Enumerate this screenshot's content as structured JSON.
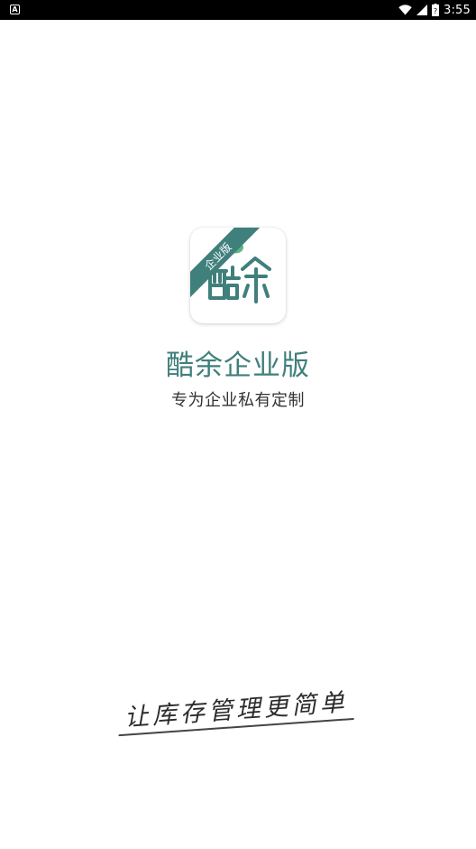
{
  "status_bar": {
    "left_icon_label": "A",
    "left_icon": "notification-a-icon",
    "wifi_icon": "wifi-icon",
    "signal_icon": "signal-icon",
    "battery_icon": "battery-icon",
    "time": "3:55"
  },
  "app_icon": {
    "ribbon_label": "企业版",
    "logo_icon": "kuyu-logo-icon",
    "colors": {
      "primary": "#3f7f7c",
      "accent": "#5cb87a"
    }
  },
  "app_name": "酷余企业版",
  "tagline": "专为企业私有定制",
  "slogan": "让库存管理更简单"
}
